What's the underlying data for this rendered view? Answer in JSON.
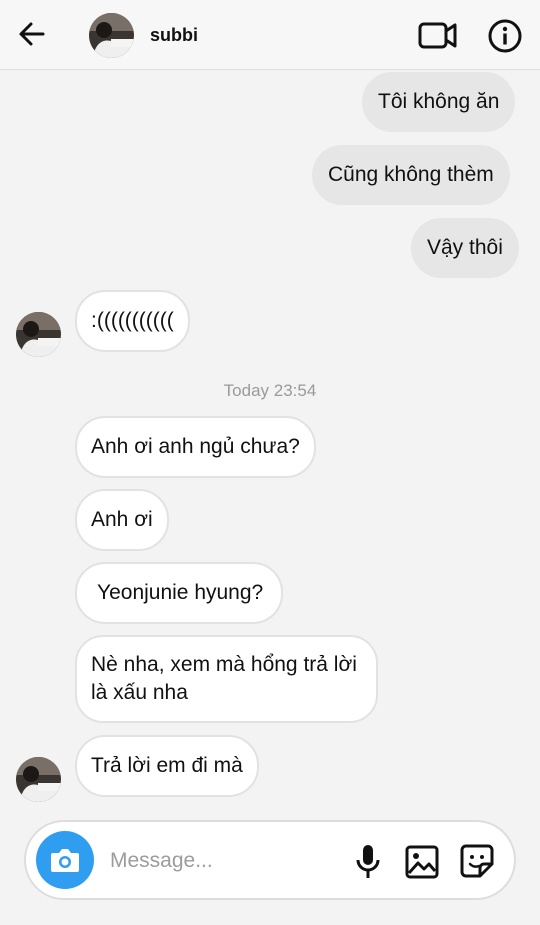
{
  "header": {
    "username": "subbi",
    "back_icon": "arrow-left-icon",
    "video_icon": "video-camera-icon",
    "info_icon": "info-icon"
  },
  "messages": [
    {
      "from": "me",
      "text": "Tôi không ăn"
    },
    {
      "from": "me",
      "text": "Cũng không thèm"
    },
    {
      "from": "me",
      "text": "Vậy thôi"
    },
    {
      "from": "them",
      "text": ":((((((((((("
    },
    {
      "from": "them",
      "text": "Anh ơi anh ngủ chưa?"
    },
    {
      "from": "them",
      "text": "Anh ơi"
    },
    {
      "from": "them",
      "text": "Yeonjunie hyung?"
    },
    {
      "from": "them",
      "text": "Nè nha, xem mà hổng trả lời là xấu nha"
    },
    {
      "from": "them",
      "text": "Trả lời em đi mà"
    }
  ],
  "timestamp": "Today 23:54",
  "composer": {
    "placeholder": "Message...",
    "camera_icon": "camera-icon",
    "mic_icon": "microphone-icon",
    "gallery_icon": "image-icon",
    "sticker_icon": "sticker-icon"
  },
  "colors": {
    "background": "#f3f3f3",
    "sent_bubble": "#e6e6e6",
    "received_bubble": "#ffffff",
    "camera_button": "#2f9ef0",
    "timestamp": "#9a9a9a"
  }
}
